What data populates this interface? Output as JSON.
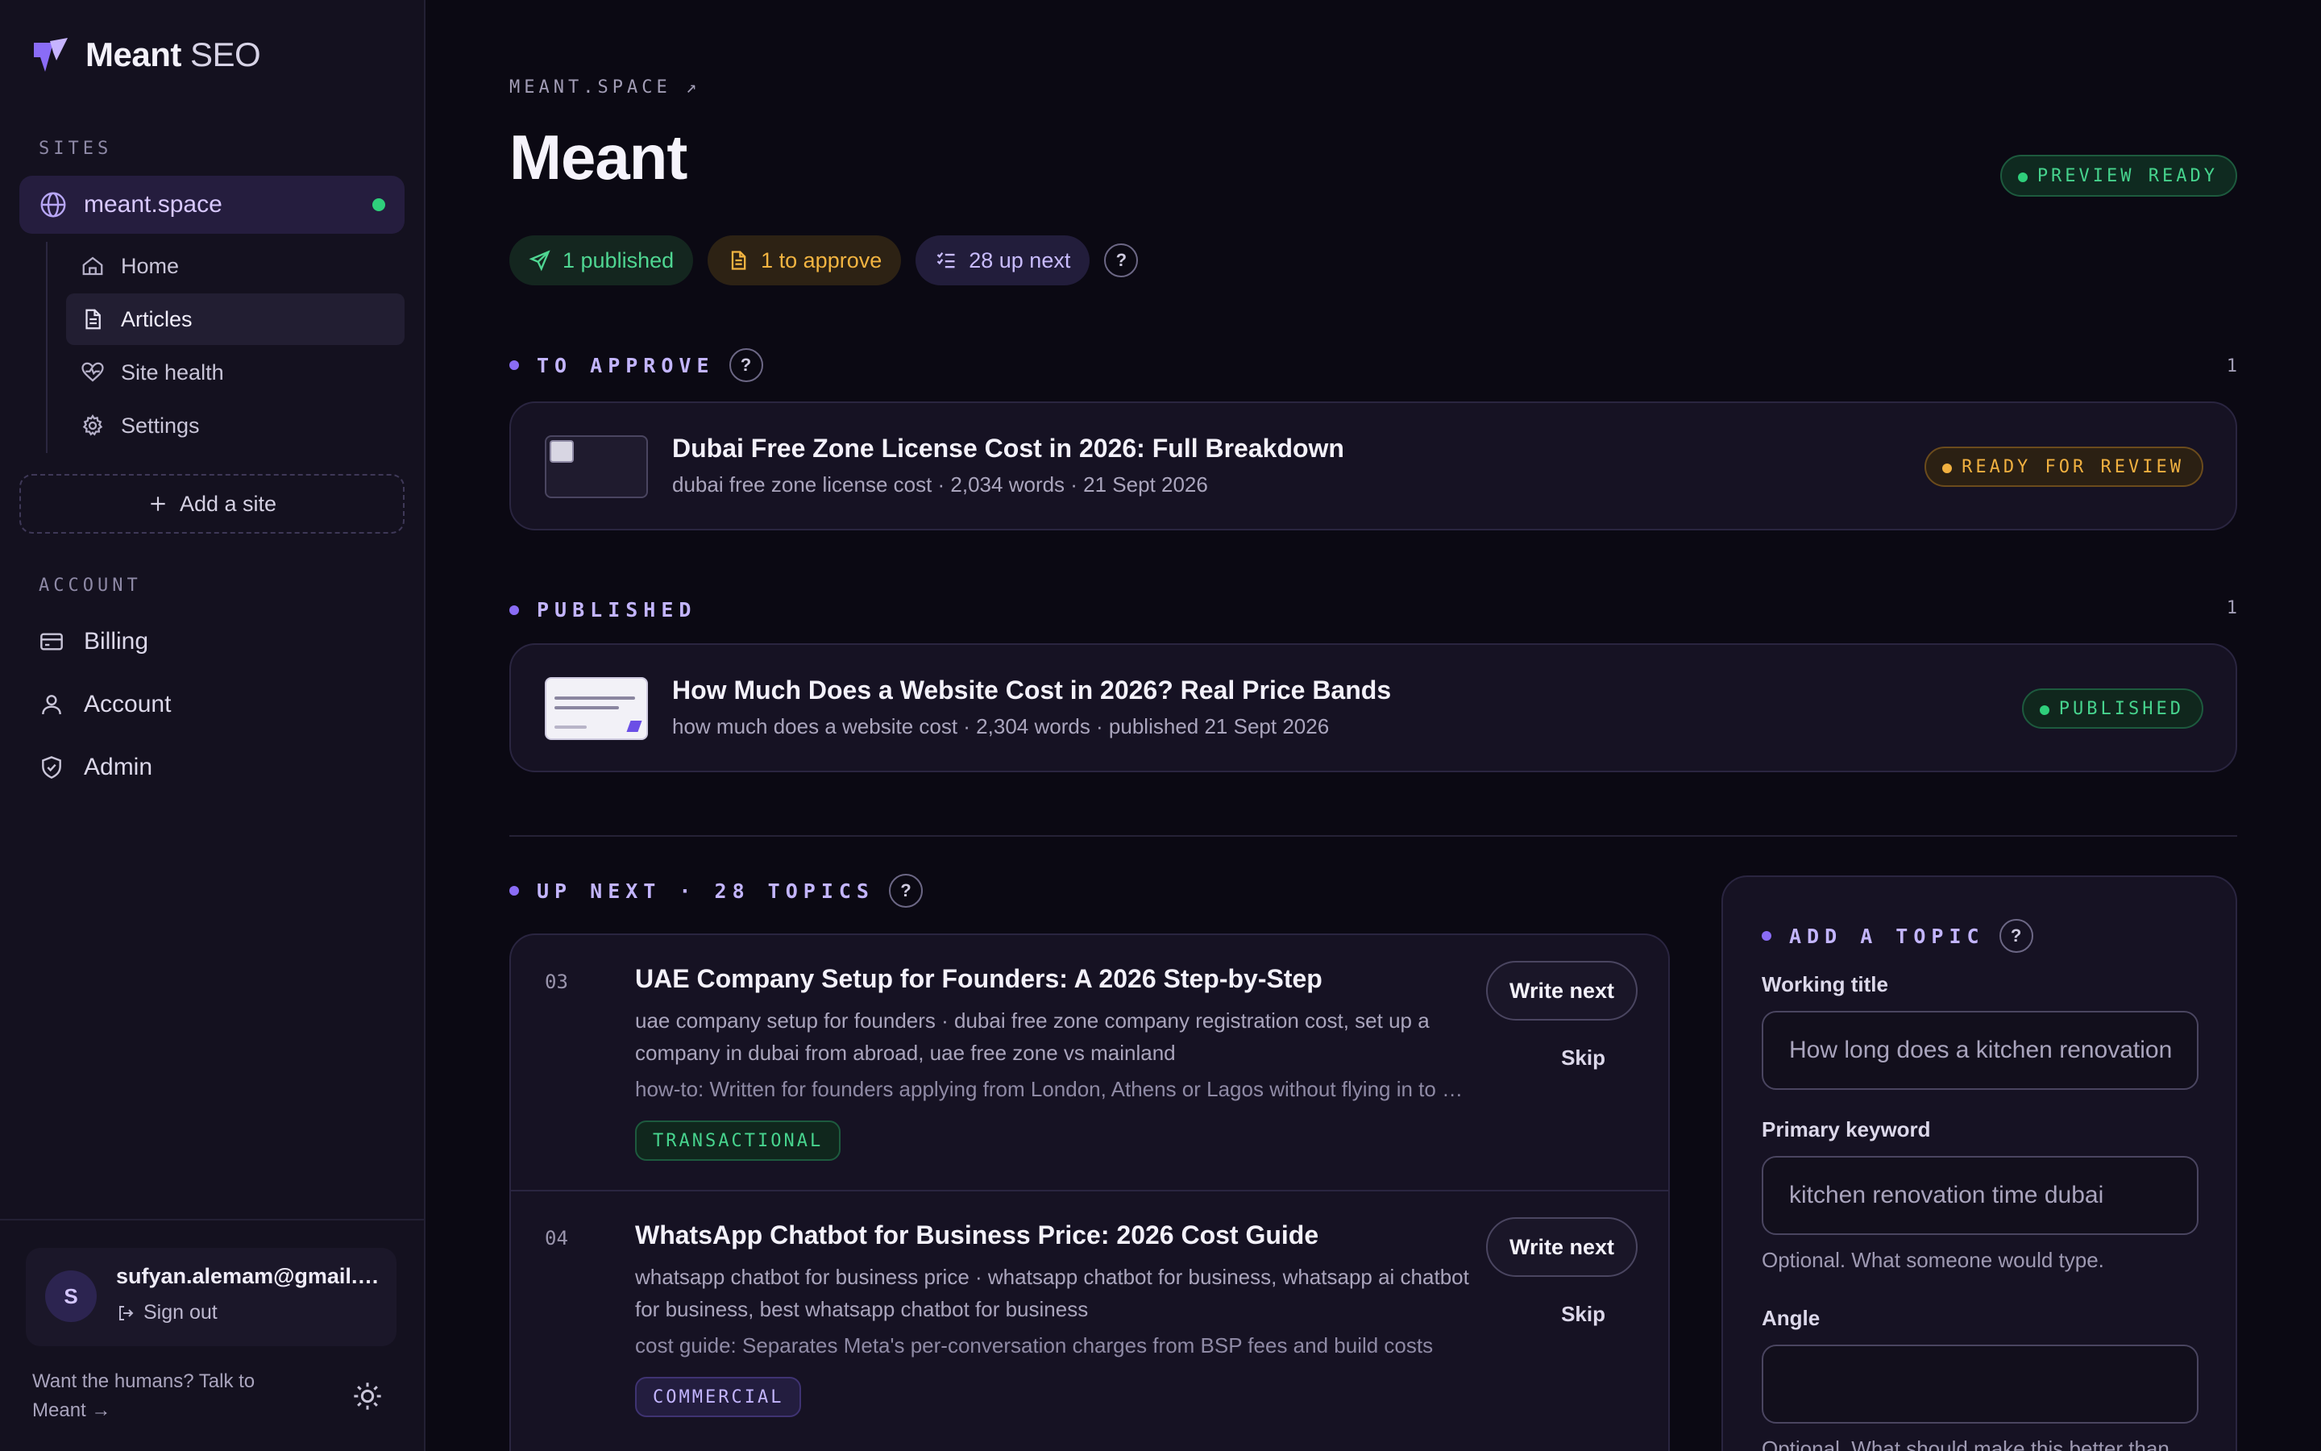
{
  "brand": {
    "name_bold": "Meant",
    "name_light": "SEO"
  },
  "sidebar": {
    "sites_label": "SITES",
    "site": {
      "name": "meant.space",
      "status_color": "#2fcf7b"
    },
    "subnav": [
      {
        "label": "Home",
        "icon": "home-icon"
      },
      {
        "label": "Articles",
        "icon": "document-icon",
        "active": true
      },
      {
        "label": "Site health",
        "icon": "heart-pulse-icon"
      },
      {
        "label": "Settings",
        "icon": "gear-icon"
      }
    ],
    "add_site_label": "Add a site",
    "account_label": "ACCOUNT",
    "account_items": [
      {
        "label": "Billing",
        "icon": "credit-card-icon"
      },
      {
        "label": "Account",
        "icon": "user-icon"
      },
      {
        "label": "Admin",
        "icon": "shield-icon"
      }
    ],
    "user": {
      "initial": "S",
      "email": "sufyan.alemam@gmail.com",
      "sign_out": "Sign out"
    },
    "help_text": "Want the humans? Talk to Meant →"
  },
  "main": {
    "breadcrumb": "MEANT.SPACE ↗",
    "title": "Meant",
    "preview_badge": "PREVIEW READY",
    "chips": {
      "published": "1 published",
      "to_approve": "1 to approve",
      "up_next": "28 up next",
      "help": "?"
    },
    "to_approve": {
      "heading": "TO APPROVE",
      "count": "1",
      "article": {
        "title": "Dubai Free Zone License Cost in 2026: Full Breakdown",
        "meta": "dubai free zone license cost · 2,034 words · 21 Sept 2026",
        "status": "READY FOR REVIEW"
      }
    },
    "published": {
      "heading": "PUBLISHED",
      "count": "1",
      "article": {
        "title": "How Much Does a Website Cost in 2026? Real Price Bands",
        "meta": "how much does a website cost · 2,304 words · published 21 Sept 2026",
        "status": "PUBLISHED"
      }
    },
    "up_next": {
      "heading": "UP NEXT · 28 TOPICS",
      "write_label": "Write next",
      "skip_label": "Skip",
      "topics": [
        {
          "num": "03",
          "title": "UAE Company Setup for Founders: A 2026 Step-by-Step",
          "keywords": "uae company setup for founders · dubai free zone company registration cost, set up a company in dubai from abroad, uae free zone vs mainland",
          "note": "how-to: Written for founders applying from London, Athens or Lagos without flying in to Dubai",
          "intent": "TRANSACTIONAL"
        },
        {
          "num": "04",
          "title": "WhatsApp Chatbot for Business Price: 2026 Cost Guide",
          "keywords": "whatsapp chatbot for business price · whatsapp chatbot for business, whatsapp ai chatbot for business, best whatsapp chatbot for business",
          "note": "cost guide: Separates Meta's per-conversation charges from BSP fees and build costs",
          "intent": "COMMERCIAL"
        }
      ]
    },
    "add_topic": {
      "heading": "ADD A TOPIC",
      "working_title_label": "Working title",
      "working_title_placeholder": "How long does a kitchen renovation take in Dubai?",
      "keyword_label": "Primary keyword",
      "keyword_placeholder": "kitchen renovation time dubai",
      "keyword_hint": "Optional. What someone would type.",
      "angle_label": "Angle",
      "angle_hint": "Optional. What should make this better than"
    }
  }
}
